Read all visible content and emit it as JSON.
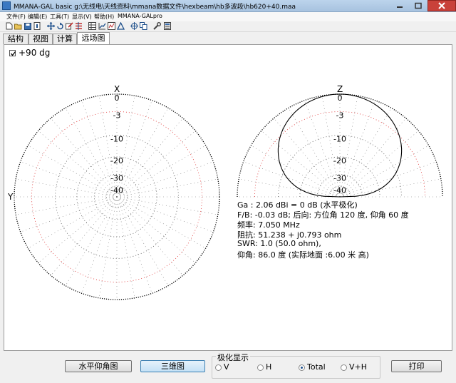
{
  "window": {
    "title": "MMANA-GAL basic g:\\无线电\\天线资料\\mmana数据文件\\hexbeam\\hb多波段\\hb620+40.maa"
  },
  "menu": [
    "文件(F)",
    "编辑(E)",
    "工具(T)",
    "显示(V)",
    "帮助(H)",
    "MMANA-GALpro"
  ],
  "tabs": [
    {
      "label": "结构",
      "active": false
    },
    {
      "label": "视图",
      "active": false
    },
    {
      "label": "计算",
      "active": false
    },
    {
      "label": "远场图",
      "active": true
    }
  ],
  "plot": {
    "checkbox_label": "+90 dg",
    "checkbox_checked": true,
    "azimuth": {
      "top_label": "X",
      "side_label": "Y"
    },
    "elevation": {
      "top_label": "Z"
    },
    "ring_labels": [
      "0",
      "-3",
      "-10",
      "-20",
      "-30",
      "-40"
    ],
    "trace_color": "#000000",
    "grid_color": "#e03030",
    "elevation_lobe_pattern": {
      "unit": "dB (normalized)",
      "peak_elevation_deg": 86.0,
      "peak_db": 0,
      "lobe_width_deg": 180
    }
  },
  "info": [
    "Ga : 2.06 dBi = 0 dB  (水平极化)",
    "F/B: -0.03 dB; 后向: 方位角 120 度, 仰角 60 度",
    "频率: 7.050 MHz",
    "阻抗: 51.238 + j0.793 ohm",
    "SWR: 1.0 (50.0 ohm),",
    "仰角: 86.0 度 (实际地面  :6.00 米 高)"
  ],
  "buttons": {
    "horizontal_elevation": "水平仰角图",
    "three_d": "三维图",
    "print": "打印"
  },
  "polarization": {
    "title": "极化显示",
    "options": [
      "V",
      "H",
      "Total",
      "V+H"
    ],
    "selected": "Total"
  }
}
